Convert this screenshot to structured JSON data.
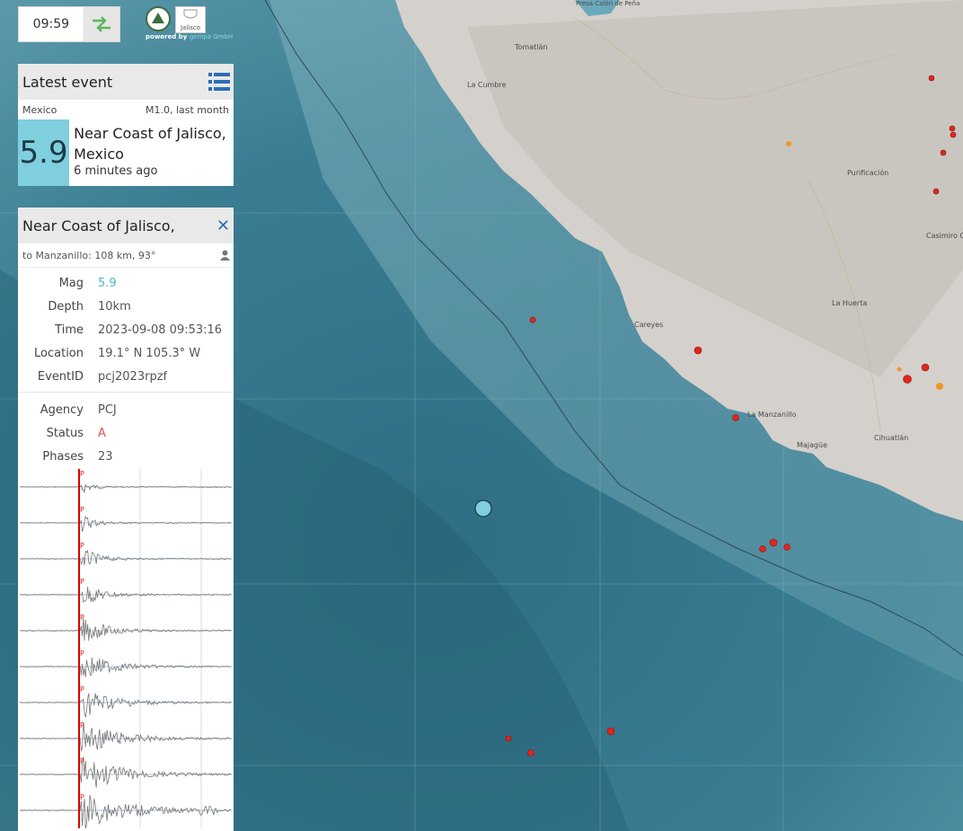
{
  "clock": {
    "time": "09:59",
    "refresh_icon": "swap-arrows-icon"
  },
  "branding": {
    "logo_a": "seismology-logo",
    "logo_b_text": "Jalisco",
    "powered_prefix": "powered by ",
    "powered_brand": "gempa GmbH"
  },
  "latest_event": {
    "title": "Latest event",
    "list_icon": "list-icon",
    "country": "Mexico",
    "summary": "M1.0, last month",
    "magnitude": "5.9",
    "region": "Near Coast of Jalisco, Mexico",
    "time_ago": "6 minutes ago",
    "accent": "#7fcfdf"
  },
  "details": {
    "title": "Near Coast of Jalisco,",
    "close_icon": "close-icon",
    "distance": "to Manzanillo: 108 km, 93°",
    "user_icon": "user-icon",
    "fields": [
      {
        "key": "Mag",
        "value": "5.9",
        "color": "#4bb5c9"
      },
      {
        "key": "Depth",
        "value": "10km"
      },
      {
        "key": "Time",
        "value": "2023-09-08 09:53:16"
      },
      {
        "key": "Location",
        "value": "19.1° N 105.3° W"
      },
      {
        "key": "EventID",
        "value": "pcj2023rpzf"
      }
    ],
    "fields2": [
      {
        "key": "Agency",
        "value": "PCJ"
      },
      {
        "key": "Status",
        "value": "A",
        "color": "#d9534f"
      },
      {
        "key": "Phases",
        "value": "23"
      }
    ],
    "phase_label": "P",
    "trace_count": 10
  },
  "map": {
    "labels": [
      "Presa Calón de Peña",
      "Tomatlán",
      "La Cumbre",
      "Purificación",
      "Casimiro C",
      "La Huerta",
      "Careyes",
      "La Manzanillo",
      "Majagüe",
      "Cihuatlán"
    ],
    "colors": {
      "ocean": "#3f7f92",
      "land": "#d4d1cc",
      "event": "#e0261f",
      "main_event": "#7fcfdf"
    }
  }
}
